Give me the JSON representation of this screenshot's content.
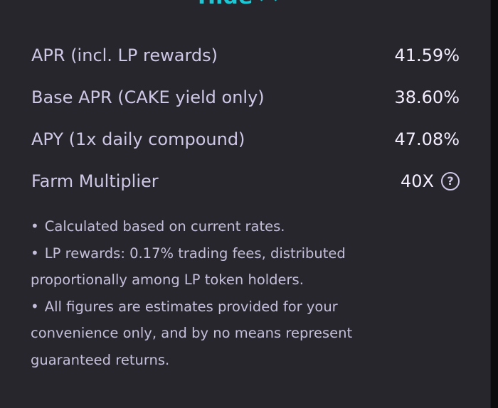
{
  "toggle": {
    "label": "Hide",
    "icon": "chevron-up-icon"
  },
  "metrics": [
    {
      "label": "APR (incl. LP rewards)",
      "value": "41.59%"
    },
    {
      "label": "Base APR (CAKE yield only)",
      "value": "38.60%"
    },
    {
      "label": "APY (1x daily compound)",
      "value": "47.08%"
    },
    {
      "label": "Farm Multiplier",
      "value": "40X",
      "icon": "help-circle-icon"
    }
  ],
  "notes": [
    "Calculated based on current rates.",
    "LP rewards: 0.17% trading fees, distributed proportionally among LP token holders.",
    "All figures are estimates provided for your convenience only, and by no means represent guaranteed returns."
  ],
  "help_icon_glyph": "?",
  "colors": {
    "panel_background": "#27262c",
    "accent": "#1fc7d4",
    "text_primary": "#f4eeff",
    "text_secondary": "#cfc7e6"
  }
}
